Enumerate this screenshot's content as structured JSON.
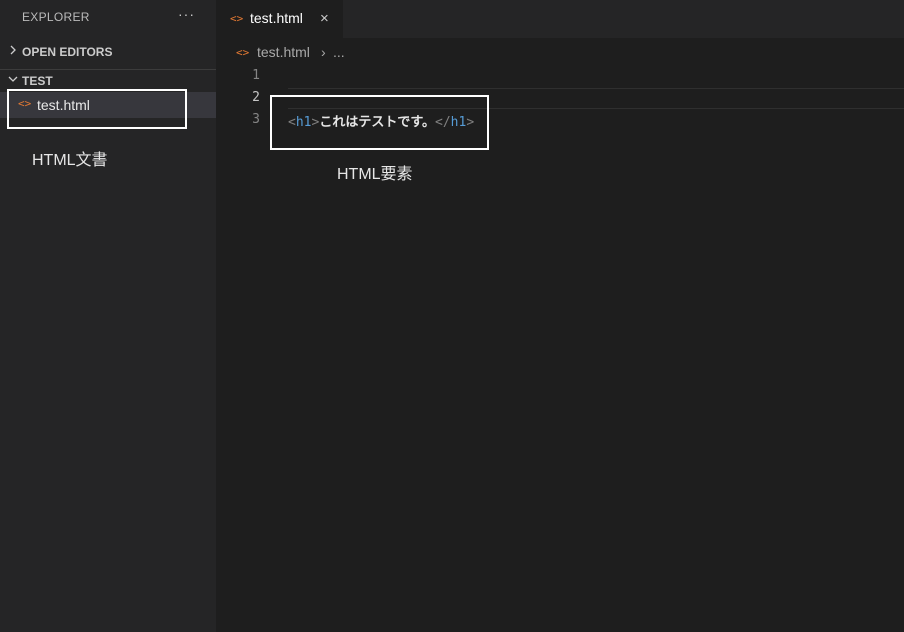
{
  "sidebar": {
    "title": "EXPLORER",
    "more": "···",
    "sections": [
      {
        "label": "OPEN EDITORS"
      },
      {
        "label": "TEST"
      }
    ],
    "files": [
      {
        "icon": "<>",
        "name": "test.html"
      }
    ]
  },
  "tabs": [
    {
      "icon": "<>",
      "label": "test.html",
      "close": "×"
    }
  ],
  "breadcrumb": {
    "icon": "<>",
    "file": "test.html",
    "separator": "›",
    "ellipsis": "..."
  },
  "editor": {
    "line_numbers": [
      "1",
      "2",
      "3"
    ],
    "line3": {
      "open_lt": "<",
      "open_tag": "h1",
      "open_gt": ">",
      "text": "これはテストです。",
      "close_lt": "</",
      "close_tag": "h1",
      "close_gt": ">"
    }
  },
  "annotations": {
    "document_label": "HTML文書",
    "element_label": "HTML要素"
  },
  "colors": {
    "file_icon": "#e37933",
    "tag": "#569cd6",
    "annotation_border": "#ffffff"
  }
}
